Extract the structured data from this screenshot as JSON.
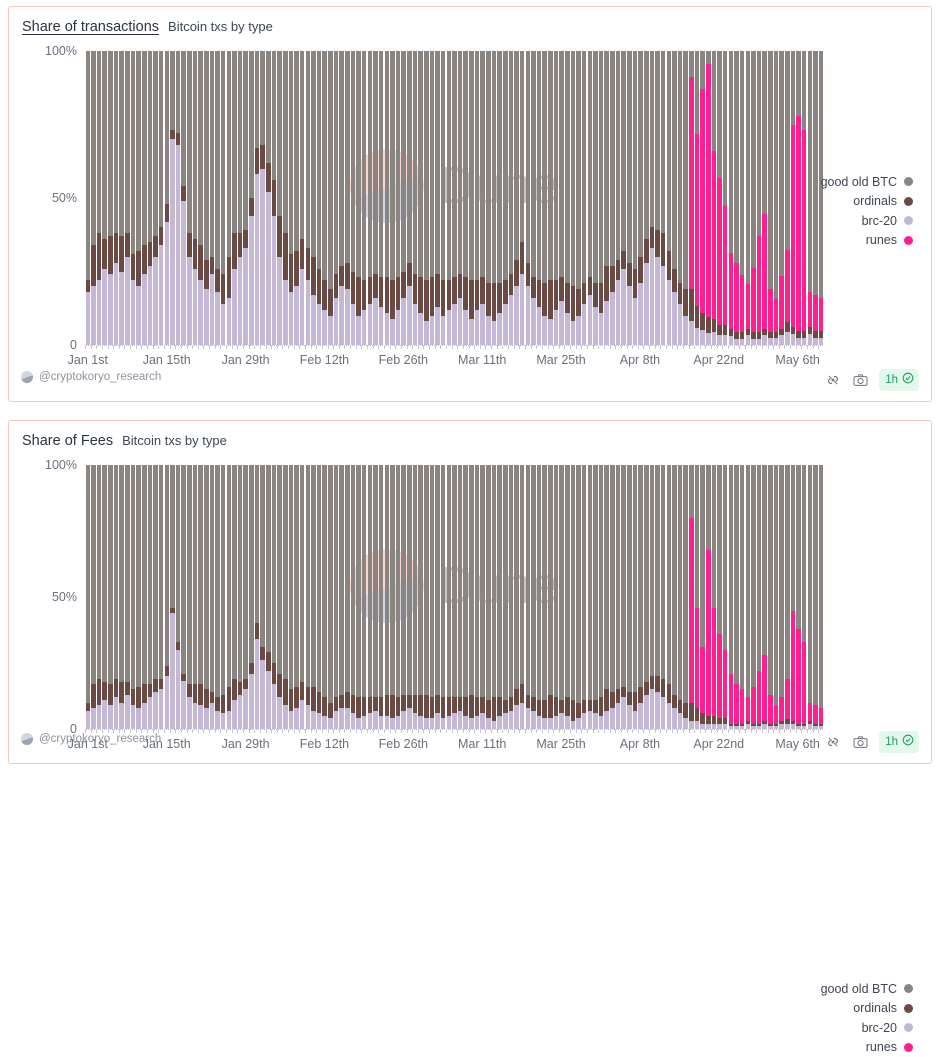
{
  "theme": {
    "panel_border": "#f2c7ba",
    "background": "#ffffff",
    "good_old_btc": "#8a8580",
    "ordinals": "#6b4a44",
    "brc20": "#c5b8d6",
    "runes": "#ff1f8f",
    "accent_green": "#1f9d63"
  },
  "watermark": {
    "text": "Dune"
  },
  "panels": [
    {
      "id": "tx",
      "title": "Share of transactions",
      "title_underlined": true,
      "subtitle": "Bitcoin txs by type",
      "author": "@cryptokoryo_research",
      "avatar_icon": "avatar-circle-icon",
      "tools": {
        "embed_icon": "embed-link-icon",
        "camera_icon": "camera-icon",
        "refresh_label": "1h",
        "refresh_check_icon": "check-circle-icon"
      }
    },
    {
      "id": "fee",
      "title": "Share of Fees",
      "title_underlined": false,
      "subtitle": "Bitcoin txs by type",
      "author": "@cryptokoryo_research",
      "avatar_icon": "avatar-circle-icon",
      "tools": {
        "embed_icon": "embed-link-icon",
        "camera_icon": "camera-icon",
        "refresh_label": "1h",
        "refresh_check_icon": "check-circle-icon"
      }
    }
  ],
  "chart_data": [
    {
      "type": "bar",
      "stacked": true,
      "normalized": true,
      "title": "Share of transactions",
      "subtitle": "Bitcoin txs by type",
      "xlabel": "",
      "ylabel": "",
      "ylim": [
        0,
        100
      ],
      "yticks": [
        "0",
        "50%",
        "100%"
      ],
      "ytick_values": [
        0,
        50,
        100
      ],
      "grid": false,
      "legend_position": "right",
      "xticks": [
        "Jan 1st",
        "Jan 15th",
        "Jan 29th",
        "Feb 12th",
        "Feb 26th",
        "Mar 11th",
        "Mar 25th",
        "Apr 8th",
        "Apr 22nd",
        "May 6th"
      ],
      "xtick_indices": [
        0,
        14,
        28,
        42,
        56,
        70,
        84,
        98,
        112,
        126
      ],
      "series": [
        {
          "name": "brc-20",
          "color": "#c5b8d6",
          "values": [
            18,
            20,
            22,
            26,
            24,
            28,
            25,
            30,
            22,
            20,
            24,
            27,
            30,
            34,
            42,
            70,
            68,
            49,
            30,
            26,
            22,
            19,
            24,
            18,
            14,
            16,
            26,
            30,
            33,
            44,
            58,
            60,
            52,
            44,
            30,
            22,
            18,
            20,
            26,
            22,
            17,
            14,
            12,
            10,
            16,
            20,
            19,
            14,
            10,
            12,
            14,
            16,
            13,
            11,
            9,
            12,
            16,
            20,
            14,
            11,
            8,
            10,
            13,
            10,
            12,
            14,
            16,
            12,
            9,
            12,
            14,
            10,
            8,
            11,
            14,
            17,
            20,
            24,
            20,
            16,
            13,
            10,
            9,
            12,
            15,
            11,
            8,
            10,
            14,
            17,
            13,
            11,
            15,
            18,
            22,
            26,
            20,
            16,
            21,
            28,
            33,
            30,
            27,
            22,
            18,
            14,
            10,
            8,
            6,
            5,
            4,
            4,
            3,
            3,
            3,
            2,
            2,
            3,
            2,
            2,
            3,
            2,
            2,
            3,
            4,
            3,
            2,
            2,
            3,
            2,
            2
          ]
        },
        {
          "name": "ordinals",
          "color": "#6b4a44",
          "values": [
            4,
            14,
            16,
            10,
            13,
            10,
            12,
            8,
            9,
            12,
            10,
            8,
            7,
            6,
            6,
            3,
            4,
            5,
            8,
            10,
            12,
            10,
            6,
            8,
            10,
            14,
            12,
            8,
            6,
            6,
            9,
            8,
            10,
            12,
            14,
            16,
            13,
            12,
            10,
            11,
            13,
            12,
            10,
            9,
            8,
            7,
            9,
            11,
            13,
            10,
            9,
            8,
            10,
            12,
            13,
            11,
            9,
            8,
            10,
            12,
            14,
            13,
            11,
            12,
            10,
            9,
            8,
            11,
            13,
            10,
            9,
            11,
            13,
            10,
            8,
            7,
            9,
            11,
            8,
            7,
            9,
            11,
            13,
            10,
            8,
            10,
            12,
            9,
            7,
            6,
            8,
            10,
            12,
            9,
            7,
            6,
            8,
            10,
            9,
            8,
            7,
            9,
            11,
            10,
            8,
            7,
            9,
            11,
            8,
            6,
            5,
            4,
            3,
            3,
            2,
            2,
            2,
            2,
            2,
            2,
            2,
            2,
            2,
            2,
            3,
            2,
            2,
            2,
            2,
            2,
            2
          ]
        },
        {
          "name": "runes",
          "color": "#ff1f8f",
          "values": [
            0,
            0,
            0,
            0,
            0,
            0,
            0,
            0,
            0,
            0,
            0,
            0,
            0,
            0,
            0,
            0,
            0,
            0,
            0,
            0,
            0,
            0,
            0,
            0,
            0,
            0,
            0,
            0,
            0,
            0,
            0,
            0,
            0,
            0,
            0,
            0,
            0,
            0,
            0,
            0,
            0,
            0,
            0,
            0,
            0,
            0,
            0,
            0,
            0,
            0,
            0,
            0,
            0,
            0,
            0,
            0,
            0,
            0,
            0,
            0,
            0,
            0,
            0,
            0,
            0,
            0,
            0,
            0,
            0,
            0,
            0,
            0,
            0,
            0,
            0,
            0,
            0,
            0,
            0,
            0,
            0,
            0,
            0,
            0,
            0,
            0,
            0,
            0,
            0,
            0,
            0,
            0,
            0,
            0,
            0,
            0,
            0,
            0,
            0,
            0,
            0,
            0,
            0,
            0,
            0,
            0,
            0,
            72,
            62,
            76,
            81,
            52,
            44,
            36,
            24,
            22,
            18,
            14,
            20,
            30,
            36,
            13,
            10,
            16,
            22,
            57,
            60,
            56,
            10,
            10,
            9
          ]
        },
        {
          "name": "good old BTC",
          "color": "#8a8580",
          "values": [
            78,
            66,
            62,
            64,
            63,
            62,
            63,
            62,
            69,
            68,
            66,
            65,
            63,
            60,
            52,
            27,
            28,
            46,
            62,
            64,
            66,
            71,
            70,
            74,
            76,
            70,
            62,
            62,
            61,
            50,
            33,
            32,
            38,
            44,
            56,
            62,
            69,
            68,
            64,
            67,
            70,
            74,
            78,
            81,
            76,
            73,
            72,
            75,
            77,
            78,
            77,
            76,
            77,
            77,
            78,
            77,
            75,
            72,
            76,
            77,
            78,
            77,
            76,
            78,
            78,
            77,
            76,
            77,
            78,
            78,
            77,
            79,
            79,
            79,
            78,
            76,
            71,
            65,
            72,
            77,
            78,
            79,
            78,
            78,
            77,
            79,
            80,
            81,
            79,
            77,
            79,
            79,
            73,
            73,
            71,
            68,
            72,
            74,
            70,
            64,
            60,
            61,
            62,
            68,
            74,
            79,
            81,
            9,
            30,
            13,
            4,
            31,
            38,
            47,
            64,
            67,
            70,
            73,
            68,
            58,
            51,
            73,
            76,
            69,
            61,
            21,
            18,
            22,
            68,
            68,
            69
          ]
        }
      ]
    },
    {
      "type": "bar",
      "stacked": true,
      "normalized": true,
      "title": "Share of Fees",
      "subtitle": "Bitcoin txs by type",
      "xlabel": "",
      "ylabel": "",
      "ylim": [
        0,
        100
      ],
      "yticks": [
        "0",
        "50%",
        "100%"
      ],
      "ytick_values": [
        0,
        50,
        100
      ],
      "grid": false,
      "legend_position": "right",
      "xticks": [
        "Jan 1st",
        "Jan 15th",
        "Jan 29th",
        "Feb 12th",
        "Feb 26th",
        "Mar 11th",
        "Mar 25th",
        "Apr 8th",
        "Apr 22nd",
        "May 6th"
      ],
      "xtick_indices": [
        0,
        14,
        28,
        42,
        56,
        70,
        84,
        98,
        112,
        126
      ],
      "series": [
        {
          "name": "brc-20",
          "color": "#c5b8d6",
          "values": [
            7,
            8,
            9,
            11,
            9,
            12,
            10,
            13,
            9,
            8,
            10,
            12,
            14,
            15,
            20,
            44,
            30,
            18,
            12,
            10,
            9,
            8,
            10,
            7,
            6,
            7,
            11,
            13,
            15,
            21,
            34,
            26,
            22,
            17,
            12,
            9,
            7,
            8,
            11,
            9,
            7,
            6,
            5,
            4,
            7,
            8,
            8,
            6,
            4,
            5,
            6,
            7,
            5,
            5,
            4,
            5,
            7,
            8,
            6,
            5,
            4,
            4,
            6,
            4,
            5,
            6,
            7,
            5,
            4,
            5,
            6,
            4,
            3,
            5,
            6,
            7,
            9,
            10,
            8,
            7,
            5,
            4,
            4,
            5,
            6,
            5,
            3,
            4,
            6,
            7,
            6,
            5,
            7,
            8,
            10,
            12,
            9,
            7,
            10,
            13,
            15,
            14,
            12,
            10,
            8,
            6,
            4,
            3,
            3,
            2,
            2,
            2,
            2,
            2,
            1,
            1,
            1,
            2,
            1,
            1,
            2,
            1,
            1,
            2,
            2,
            2,
            1,
            1,
            2,
            1,
            1
          ]
        },
        {
          "name": "ordinals",
          "color": "#6b4a44",
          "values": [
            3,
            9,
            10,
            7,
            8,
            7,
            8,
            5,
            6,
            8,
            7,
            5,
            5,
            4,
            4,
            2,
            3,
            3,
            5,
            7,
            8,
            7,
            4,
            5,
            7,
            9,
            8,
            5,
            4,
            4,
            6,
            5,
            7,
            8,
            9,
            10,
            8,
            8,
            7,
            7,
            9,
            8,
            7,
            6,
            5,
            5,
            6,
            7,
            8,
            7,
            6,
            5,
            7,
            8,
            9,
            7,
            6,
            5,
            7,
            8,
            9,
            8,
            7,
            8,
            7,
            6,
            5,
            7,
            9,
            7,
            6,
            7,
            9,
            7,
            5,
            5,
            6,
            7,
            5,
            5,
            6,
            7,
            9,
            7,
            5,
            7,
            8,
            6,
            5,
            4,
            5,
            7,
            8,
            6,
            5,
            4,
            5,
            7,
            6,
            5,
            5,
            6,
            7,
            7,
            5,
            5,
            6,
            7,
            5,
            4,
            3,
            3,
            2,
            2,
            1,
            1,
            1,
            1,
            1,
            1,
            1,
            1,
            1,
            1,
            2,
            1,
            1,
            1,
            1,
            1,
            1
          ]
        },
        {
          "name": "runes",
          "color": "#ff1f8f",
          "values": [
            0,
            0,
            0,
            0,
            0,
            0,
            0,
            0,
            0,
            0,
            0,
            0,
            0,
            0,
            0,
            0,
            0,
            0,
            0,
            0,
            0,
            0,
            0,
            0,
            0,
            0,
            0,
            0,
            0,
            0,
            0,
            0,
            0,
            0,
            0,
            0,
            0,
            0,
            0,
            0,
            0,
            0,
            0,
            0,
            0,
            0,
            0,
            0,
            0,
            0,
            0,
            0,
            0,
            0,
            0,
            0,
            0,
            0,
            0,
            0,
            0,
            0,
            0,
            0,
            0,
            0,
            0,
            0,
            0,
            0,
            0,
            0,
            0,
            0,
            0,
            0,
            0,
            0,
            0,
            0,
            0,
            0,
            0,
            0,
            0,
            0,
            0,
            0,
            0,
            0,
            0,
            0,
            0,
            0,
            0,
            0,
            0,
            0,
            0,
            0,
            0,
            0,
            0,
            0,
            0,
            0,
            0,
            70,
            38,
            25,
            63,
            41,
            32,
            26,
            19,
            15,
            13,
            9,
            14,
            20,
            25,
            11,
            7,
            9,
            15,
            42,
            36,
            31,
            7,
            7,
            6
          ]
        },
        {
          "name": "good old BTC",
          "color": "#8a8580",
          "values": [
            90,
            83,
            81,
            82,
            83,
            81,
            82,
            82,
            85,
            84,
            83,
            83,
            81,
            81,
            76,
            54,
            67,
            79,
            83,
            83,
            83,
            85,
            86,
            88,
            87,
            84,
            81,
            82,
            81,
            75,
            60,
            69,
            71,
            75,
            79,
            81,
            85,
            84,
            82,
            84,
            84,
            86,
            88,
            90,
            88,
            87,
            86,
            87,
            88,
            88,
            88,
            88,
            88,
            87,
            87,
            88,
            87,
            87,
            87,
            87,
            87,
            88,
            87,
            88,
            88,
            88,
            88,
            88,
            87,
            88,
            88,
            89,
            88,
            88,
            89,
            88,
            85,
            83,
            87,
            88,
            89,
            89,
            87,
            88,
            89,
            88,
            89,
            90,
            89,
            89,
            89,
            88,
            85,
            86,
            85,
            84,
            86,
            86,
            84,
            82,
            80,
            80,
            81,
            83,
            87,
            89,
            90,
            20,
            54,
            69,
            32,
            54,
            64,
            70,
            79,
            82,
            85,
            87,
            84,
            78,
            72,
            87,
            91,
            88,
            82,
            56,
            62,
            67,
            90,
            91,
            92
          ]
        }
      ]
    }
  ]
}
